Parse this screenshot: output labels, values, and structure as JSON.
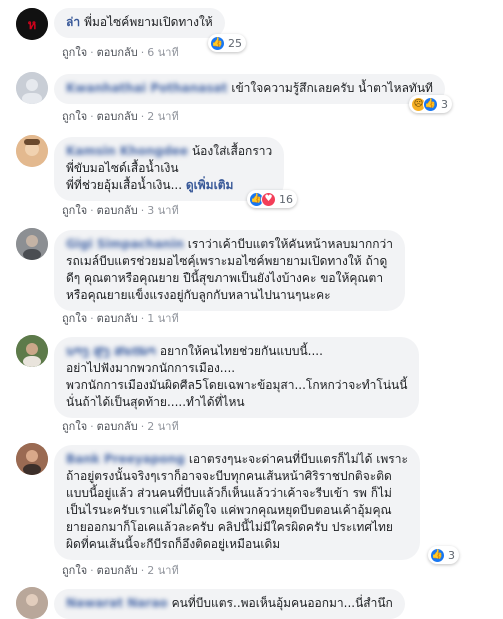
{
  "comments": [
    {
      "name": "ล่า",
      "lines": [
        "พี่มอไซค์พยามเปิดทางให้"
      ],
      "like_label": "ถูกใจ",
      "reply_label": "ตอบกลับ",
      "time": "6 นาที",
      "reaction_count": "25",
      "reaction_icons": [
        "like-icon"
      ],
      "colors": {
        "avatar_bg": "#111111",
        "avatar_mark": "#d0021b"
      }
    },
    {
      "name": "Kwanhathai Pothanasat",
      "lines": [
        "เข้าใจความรู้สึกเลยครับ น้ำตาไหลทันที"
      ],
      "like_label": "ถูกใจ",
      "reply_label": "ตอบกลับ",
      "time": "2 นาที",
      "reaction_count": "3",
      "reaction_icons": [
        "sad-icon",
        "like-icon"
      ],
      "colors": {
        "avatar_bg": "#c9ced6"
      }
    },
    {
      "name": "Kamsin Khongdee",
      "lines": [
        "น้องใส่เสื้อกราว",
        "พี่ขับมอไซด์เสื้อน้ำเงิน",
        "พี่ที่ช่วยอุ้มเสื้อน้ำเงิน..."
      ],
      "see_more": "ดูเพิ่มเติม",
      "like_label": "ถูกใจ",
      "reply_label": "ตอบกลับ",
      "time": "3 นาที",
      "reaction_count": "16",
      "reaction_icons": [
        "like-icon",
        "love-icon"
      ],
      "colors": {
        "avatar_bg": "#e3b98f"
      }
    },
    {
      "name": "Gigi Simpachanin",
      "lines": [
        "เราว่าเค้าบีบแตรให้คันหน้าหลบมากกว่า",
        "รถเมล์บีบแตรช่วยมอไซคฺ์เพราะมอไซค์พยายามเปิดทางให้ ถ้าดู",
        "ดีๆ คุณตาหรือคุณยาย ปืนี้สุขภาพเป็นยังไงบ้างคะ ขอให้คุณตา",
        "หรือคุณยายแข็งแรงอยู่กับลูกกับหลานไปนานๆนะคะ"
      ],
      "like_label": "ถูกใจ",
      "reply_label": "ตอบกลับ",
      "time": "1 นาที",
      "colors": {
        "avatar_bg": "#8c8f93"
      }
    },
    {
      "name": "ນາງ ສູງ ສະໝາ",
      "lines": [
        "อยากให้คนไทยช่วยกันแบบนี้....",
        "อย่าไปฟังมากพวกนักการเมือง....",
        "พวกนักการเมืองมันผิดศีล5โดยเฉพาะข้อมุสา...โกหกว่าจะทำโน่นนี้",
        "นั่นถ้าได้เป็นสุดท้าย.....ทำได้ที่ไหน"
      ],
      "like_label": "ถูกใจ",
      "reply_label": "ตอบกลับ",
      "time": "2 นาที",
      "colors": {
        "avatar_bg": "#5d7a4a"
      }
    },
    {
      "name": "Bank Preeyapong",
      "lines": [
        "เอาตรงๆนะจะด่าคนที่บีบแตรก็ไม่ได้ เพราะ",
        "ถ้าอยู่ตรงนั้นจริงๆเราก็อาจจะบีบทุกคนเส้นหน้าศิริราชปกติจะติด",
        "แบบนี้อยู่แล้ว ส่วนคนที่บีบแล้วก็เห็นแล้วว่าเค้าจะรีบเข้า รพ ก็ไม่",
        "เป็นไรนะครับเราแค่ไม่ได้ดูใจ แค่พวกคุณหยุดบีบตอนเค้าอุ้มคุณ",
        "ยายออกมาก็โอเคแล้วละครับ คลิปนี้ไม่มีใครผิดครับ ประเทศไทย",
        "ผิดที่คนเส้นนี้จะกีบีรถก็อึงติดอยู่เหมือนเดิม"
      ],
      "like_label": "ถูกใจ",
      "reply_label": "ตอบกลับ",
      "time": "2 นาที",
      "reaction_count": "3",
      "reaction_icons": [
        "like-icon"
      ],
      "colors": {
        "avatar_bg": "#9a6a52"
      }
    },
    {
      "name": "Nawarat Narao",
      "lines": [
        "คนที่บีบแตร..พอเห็นอุ้มคนออกมา...นี่สำนึก"
      ],
      "colors": {
        "avatar_bg": "#b9a79a"
      }
    }
  ],
  "colors": {
    "bubble_bg": "#f2f3f5",
    "name": "#385898",
    "meta": "#90949c",
    "like_blue": "#1877f2",
    "love_red": "#f33e58",
    "sad_yellow": "#f7b125"
  }
}
